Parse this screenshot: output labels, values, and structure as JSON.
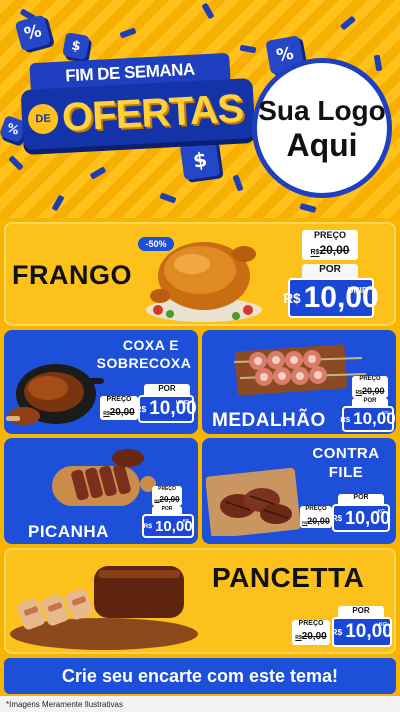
{
  "header": {
    "title_top": "FIM DE SEMANA",
    "title_de": "DE",
    "title_main": "OFERTAS",
    "logo_line1": "Sua Logo",
    "logo_line2": "Aqui",
    "cube_symbols": [
      "%",
      "$",
      "%",
      "$",
      "%"
    ]
  },
  "products": [
    {
      "name": "FRANGO",
      "discount_badge": "-50%",
      "preco_label": "PREÇO",
      "old_currency": "R$",
      "old_price": "20,00",
      "por_label": "POR",
      "currency": "R$",
      "price": "10,00",
      "unit": "UNID"
    },
    {
      "name_line1": "COXA E",
      "name_line2": "SOBRECOXA",
      "preco_label": "PREÇO",
      "old_currency": "R$",
      "old_price": "20,00",
      "por_label": "POR",
      "currency": "R$",
      "price": "10,00",
      "unit": "UNID"
    },
    {
      "name": "MEDALHÃO",
      "preco_label": "PREÇO",
      "old_currency": "R$",
      "old_price": "20,00",
      "por_label": "POR",
      "currency": "R$",
      "price": "10,00",
      "unit": "KG"
    },
    {
      "name": "PICANHA",
      "preco_label": "PREÇO",
      "old_currency": "R$",
      "old_price": "20,00",
      "por_label": "POR",
      "currency": "R$",
      "price": "10,00",
      "unit": "KG"
    },
    {
      "name_line1": "CONTRA",
      "name_line2": "FILE",
      "preco_label": "PREÇO",
      "old_currency": "R$",
      "old_price": "20,00",
      "por_label": "POR",
      "currency": "R$",
      "price": "10,00",
      "unit": "KG"
    },
    {
      "name": "PANCETTA",
      "preco_label": "PREÇO",
      "old_currency": "R$",
      "old_price": "20,00",
      "por_label": "POR",
      "currency": "R$",
      "price": "10,00",
      "unit": "KG"
    }
  ],
  "cta": "Crie seu encarte com este tema!",
  "disclaimer": "*Imagens Meramente Ilustrativas",
  "colors": {
    "yellow": "#fcc21b",
    "blue": "#1d4fd8",
    "dark_blue": "#1533a8",
    "price_yellow": "#ffd23d"
  }
}
